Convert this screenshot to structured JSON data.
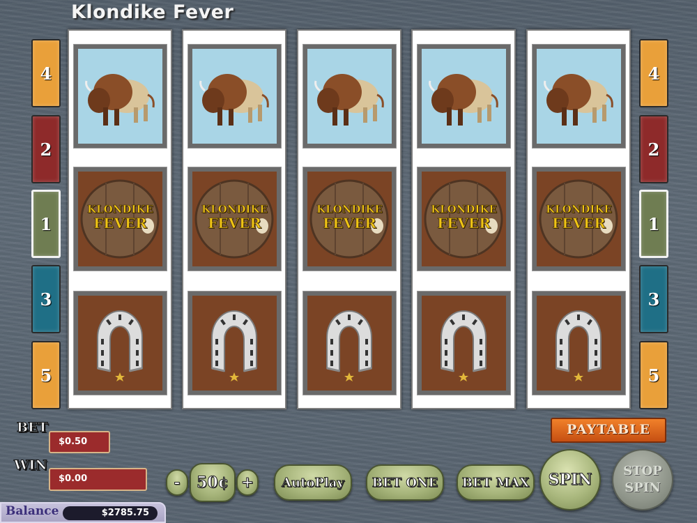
{
  "game": {
    "title": "Klondike Fever"
  },
  "lines": {
    "left": [
      {
        "label": "4",
        "color": "#e9a03a"
      },
      {
        "label": "2",
        "color": "#8e2a2a"
      },
      {
        "label": "1",
        "color": "#6f7d52"
      },
      {
        "label": "3",
        "color": "#1f6f86"
      },
      {
        "label": "5",
        "color": "#e9a03a"
      }
    ],
    "right": [
      {
        "label": "4",
        "color": "#e9a03a"
      },
      {
        "label": "2",
        "color": "#8e2a2a"
      },
      {
        "label": "1",
        "color": "#6f7d52"
      },
      {
        "label": "3",
        "color": "#1f6f86"
      },
      {
        "label": "5",
        "color": "#e9a03a"
      }
    ]
  },
  "reels": [
    [
      "buffalo-icon",
      "klondike-fever-logo",
      "horseshoe-icon"
    ],
    [
      "buffalo-icon",
      "klondike-fever-logo",
      "horseshoe-icon"
    ],
    [
      "buffalo-icon",
      "klondike-fever-logo",
      "horseshoe-icon"
    ],
    [
      "buffalo-icon",
      "klondike-fever-logo",
      "horseshoe-icon"
    ],
    [
      "buffalo-icon",
      "klondike-fever-logo",
      "horseshoe-icon"
    ]
  ],
  "logo_text": {
    "line1": "KLONDIKE",
    "line2": "FEVER"
  },
  "bet": {
    "label": "BET",
    "value": "$0.50"
  },
  "win": {
    "label": "WIN",
    "value": "$0.00"
  },
  "balance": {
    "label": "Balance",
    "value": "$2785.75"
  },
  "coin": {
    "minus": "-",
    "value": "50¢",
    "plus": "+"
  },
  "buttons": {
    "paytable": "PAYTABLE",
    "autoplay": "AutoPlay",
    "bet_one": "BET ONE",
    "bet_max": "BET MAX",
    "spin": "SPIN",
    "stop_line1": "STOP",
    "stop_line2": "SPIN"
  },
  "colors": {
    "accent_orange": "#e0641c",
    "bet_box": "#9b2b2c",
    "button_green": "#a6b47a"
  }
}
